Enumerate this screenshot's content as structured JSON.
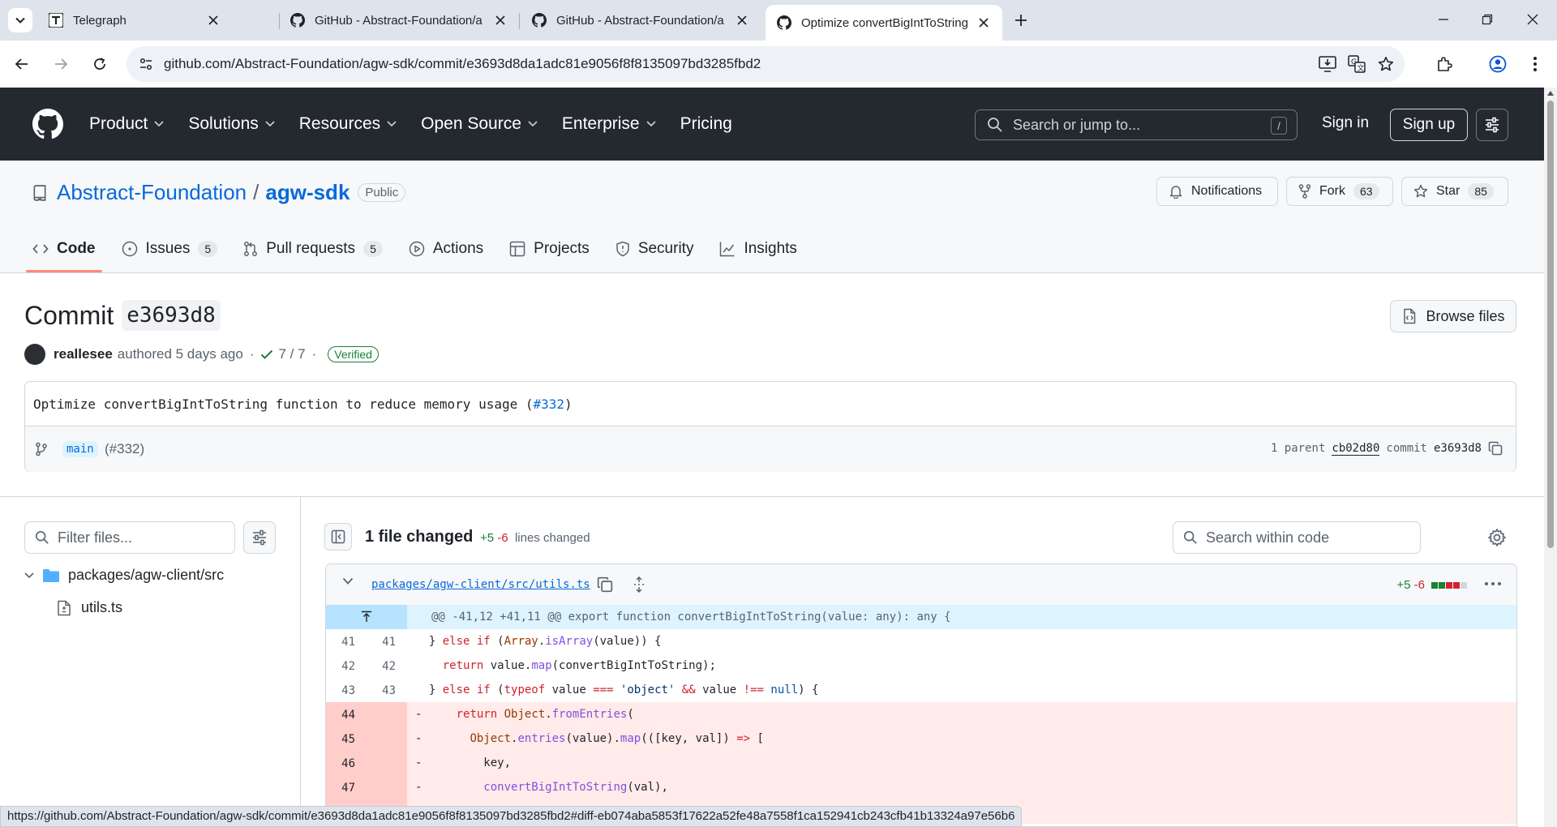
{
  "browser": {
    "tabs": [
      {
        "title": "Telegraph"
      },
      {
        "title": "GitHub - Abstract-Foundation/a"
      },
      {
        "title": "GitHub - Abstract-Foundation/a"
      },
      {
        "title": "Optimize convertBigIntToString"
      }
    ],
    "url": "github.com/Abstract-Foundation/agw-sdk/commit/e3693d8da1adc81e9056f8f8135097bd3285fbd2",
    "status_url": "https://github.com/Abstract-Foundation/agw-sdk/commit/e3693d8da1adc81e9056f8f8135097bd3285fbd2#diff-eb074aba5853f17622a52fe48a7558f1ca152941cb243cfb41b13324a97e56b6"
  },
  "gh_header": {
    "nav": [
      "Product",
      "Solutions",
      "Resources",
      "Open Source",
      "Enterprise",
      "Pricing"
    ],
    "search_placeholder": "Search or jump to...",
    "search_key": "/",
    "sign_in": "Sign in",
    "sign_up": "Sign up"
  },
  "repo": {
    "owner": "Abstract-Foundation",
    "separator": "/",
    "name": "agw-sdk",
    "visibility": "Public",
    "notifications": "Notifications",
    "fork_label": "Fork",
    "fork_count": "63",
    "star_label": "Star",
    "star_count": "85",
    "tabs": [
      {
        "label": "Code",
        "count": ""
      },
      {
        "label": "Issues",
        "count": "5"
      },
      {
        "label": "Pull requests",
        "count": "5"
      },
      {
        "label": "Actions",
        "count": ""
      },
      {
        "label": "Projects",
        "count": ""
      },
      {
        "label": "Security",
        "count": ""
      },
      {
        "label": "Insights",
        "count": ""
      }
    ]
  },
  "commit": {
    "title_prefix": "Commit",
    "short_sha": "e3693d8",
    "browse_files": "Browse files",
    "author": "reallesee",
    "authored": "authored 5 days ago",
    "dot": "·",
    "checks": "7 / 7",
    "verified": "Verified",
    "message": "Optimize convertBigIntToString function to reduce memory usage (",
    "pr_link": "#332",
    "message_end": ")",
    "branch": "main",
    "pr_ref": "(#332)",
    "parent_label": "1 parent",
    "parent_sha": "cb02d80",
    "commit_label": "commit",
    "commit_sha": "e3693d8"
  },
  "file_tree": {
    "filter_placeholder": "Filter files...",
    "folder": "packages/agw-client/src",
    "file": "utils.ts"
  },
  "diff": {
    "files_changed": "1 file changed",
    "additions": "+5",
    "deletions": "-6",
    "lines_changed": "lines changed",
    "search_placeholder": "Search within code",
    "file_path": "packages/agw-client/src/utils.ts",
    "file_additions": "+5",
    "file_deletions": "-6",
    "hunk": "@@ -41,12 +41,11 @@ export function convertBigIntToString(value: any): any {",
    "lines": [
      {
        "old": "41",
        "new": "41",
        "sign": " ",
        "code": "  } else if (Array.isArray(value)) {"
      },
      {
        "old": "42",
        "new": "42",
        "sign": " ",
        "code": "    return value.map(convertBigIntToString);"
      },
      {
        "old": "43",
        "new": "43",
        "sign": " ",
        "code": "  } else if (typeof value === 'object' && value !== null) {"
      },
      {
        "old": "44",
        "new": "",
        "sign": "-",
        "code": "    return Object.fromEntries("
      },
      {
        "old": "45",
        "new": "",
        "sign": "-",
        "code": "      Object.entries(value).map(([key, val]) => ["
      },
      {
        "old": "46",
        "new": "",
        "sign": "-",
        "code": "        key,"
      },
      {
        "old": "47",
        "new": "",
        "sign": "-",
        "code": "        convertBigIntToString(val),"
      }
    ]
  },
  "colors": {
    "accent": "#0969da",
    "header_bg": "#24292f",
    "add": "#1a7f37",
    "del": "#d1242f",
    "del_bg": "#ffebe9"
  }
}
